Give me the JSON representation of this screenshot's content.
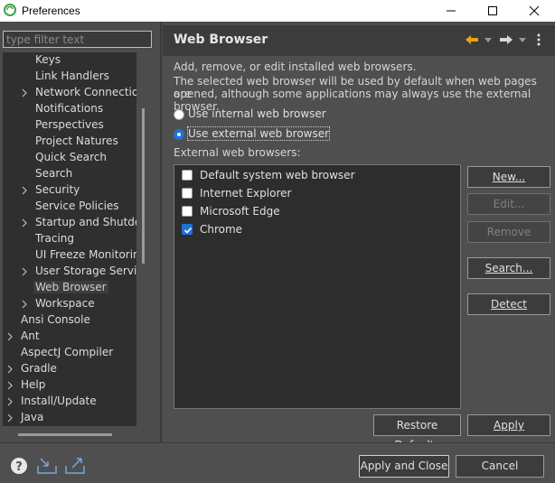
{
  "window": {
    "title": "Preferences",
    "minimize_icon": "minimize-icon",
    "maximize_icon": "maximize-icon",
    "close_icon": "close-icon"
  },
  "filter": {
    "placeholder": "type filter text",
    "value": ""
  },
  "tree": {
    "items": [
      {
        "label": "Keys",
        "level": 1,
        "expandable": false
      },
      {
        "label": "Link Handlers",
        "level": 1,
        "expandable": false
      },
      {
        "label": "Network Connection",
        "level": 1,
        "expandable": true
      },
      {
        "label": "Notifications",
        "level": 1,
        "expandable": false
      },
      {
        "label": "Perspectives",
        "level": 1,
        "expandable": false
      },
      {
        "label": "Project Natures",
        "level": 1,
        "expandable": false
      },
      {
        "label": "Quick Search",
        "level": 1,
        "expandable": false
      },
      {
        "label": "Search",
        "level": 1,
        "expandable": false
      },
      {
        "label": "Security",
        "level": 1,
        "expandable": true
      },
      {
        "label": "Service Policies",
        "level": 1,
        "expandable": false
      },
      {
        "label": "Startup and Shutdow",
        "level": 1,
        "expandable": true
      },
      {
        "label": "Tracing",
        "level": 1,
        "expandable": false
      },
      {
        "label": "UI Freeze Monitoring",
        "level": 1,
        "expandable": false
      },
      {
        "label": "User Storage Service",
        "level": 1,
        "expandable": true
      },
      {
        "label": "Web Browser",
        "level": 1,
        "expandable": false,
        "selected": true
      },
      {
        "label": "Workspace",
        "level": 1,
        "expandable": true
      },
      {
        "label": "Ansi Console",
        "level": 0,
        "expandable": false
      },
      {
        "label": "Ant",
        "level": 0,
        "expandable": true
      },
      {
        "label": "AspectJ Compiler",
        "level": 0,
        "expandable": false
      },
      {
        "label": "Gradle",
        "level": 0,
        "expandable": true
      },
      {
        "label": "Help",
        "level": 0,
        "expandable": true
      },
      {
        "label": "Install/Update",
        "level": 0,
        "expandable": true
      },
      {
        "label": "Java",
        "level": 0,
        "expandable": true
      }
    ]
  },
  "page": {
    "title": "Web Browser",
    "back_icon": "back-arrow-icon",
    "forward_icon": "forward-arrow-icon",
    "menu_icon": "vertical-dots-menu-icon",
    "description_line1": "Add, remove, or edit installed web browsers.",
    "description_line2": "The selected web browser will be used by default when web pages are",
    "description_line3": "opened, although some applications may always use the external browser.",
    "radio_internal": "Use internal web browser",
    "radio_external": "Use external web browser",
    "selected_mode": "external",
    "external_label": "External web browsers:",
    "browsers": [
      {
        "name": "Default system web browser",
        "checked": false
      },
      {
        "name": "Internet Explorer",
        "checked": false
      },
      {
        "name": "Microsoft Edge",
        "checked": false
      },
      {
        "name": "Chrome",
        "checked": true
      }
    ],
    "buttons": {
      "new": "New...",
      "edit": "Edit...",
      "remove": "Remove",
      "search": "Search...",
      "detect": "Detect",
      "restore_defaults": "Restore Defaults",
      "apply": "Apply"
    }
  },
  "bottom": {
    "help_icon": "help-icon",
    "import_icon": "import-icon",
    "export_icon": "export-icon",
    "apply_and_close": "Apply and Close",
    "cancel": "Cancel"
  },
  "colors": {
    "accent": "#1e73d8",
    "background": "#4f4f4f",
    "tree_background": "#2f2f2f",
    "header_background": "#3c3c3c"
  }
}
